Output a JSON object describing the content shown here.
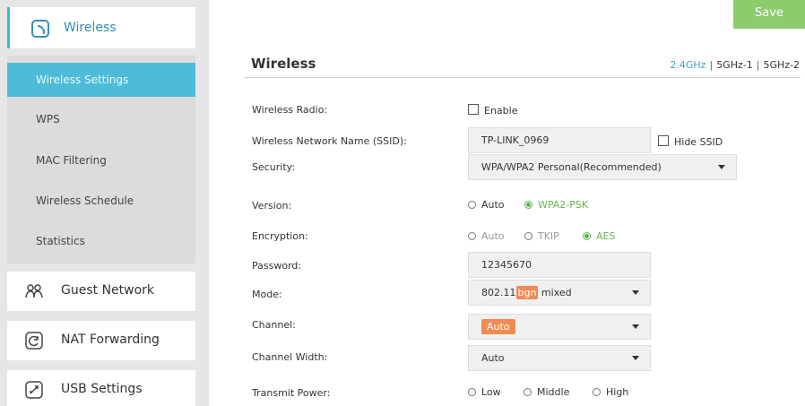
{
  "sidebar": {
    "header_label": "Wireless",
    "sub_items": [
      {
        "label": "Wireless Settings",
        "active": true
      },
      {
        "label": "WPS"
      },
      {
        "label": "MAC Filtering"
      },
      {
        "label": "Wireless Schedule"
      },
      {
        "label": "Statistics"
      }
    ],
    "nav_items": [
      {
        "label": "Guest Network"
      },
      {
        "label": "NAT Forwarding"
      },
      {
        "label": "USB Settings"
      }
    ]
  },
  "toolbar": {
    "save_label": "Save"
  },
  "main": {
    "title": "Wireless",
    "bands": {
      "b1": "2.4GHz",
      "sep": "|",
      "b2": "5GHz-1",
      "b3": "5GHz-2"
    },
    "rows": {
      "radio": {
        "label": "Wireless Radio:",
        "checkbox_label": "Enable"
      },
      "ssid": {
        "label": "Wireless Network Name (SSID):",
        "value": "TP-LINK_0969",
        "hide_label": "Hide SSID"
      },
      "security": {
        "label": "Security:",
        "value": "WPA/WPA2 Personal(Recommended)"
      },
      "version": {
        "label": "Version:",
        "opt_auto": "Auto",
        "opt_wpa2": "WPA2-PSK"
      },
      "encryption": {
        "label": "Encryption:",
        "opt_auto": "Auto",
        "opt_tkip": "TKIP",
        "opt_aes": "AES"
      },
      "password": {
        "label": "Password:",
        "value": "12345670"
      },
      "mode": {
        "label": "Mode:",
        "prefix": "802.11",
        "highlight": "bgn",
        "suffix": " mixed"
      },
      "channel": {
        "label": "Channel:",
        "value": "Auto"
      },
      "width": {
        "label": "Channel Width:",
        "value": "Auto"
      },
      "power": {
        "label": "Transmit Power:",
        "opt_low": "Low",
        "opt_middle": "Middle",
        "opt_high": "High"
      }
    }
  },
  "colors": {
    "accent": "#4dbcd9",
    "save": "#8ccc6c",
    "selected_radio": "#5fb34a",
    "highlight": "#f08b52"
  }
}
